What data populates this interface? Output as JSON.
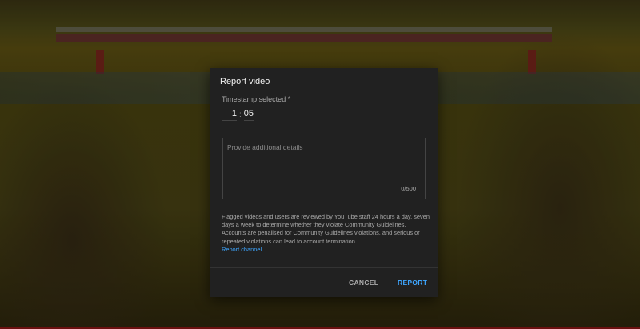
{
  "dialog": {
    "title": "Report video",
    "timestamp_label": "Timestamp selected *",
    "timestamp_minutes": "1",
    "timestamp_separator": ":",
    "timestamp_seconds": "05",
    "details_placeholder": "Provide additional details",
    "details_value": "",
    "char_count": "0/500",
    "info_text": "Flagged videos and users are reviewed by YouTube staff 24 hours a day, seven days a week to determine whether they violate Community Guidelines. Accounts are penalised for Community Guidelines violations, and serious or repeated violations can lead to account termination.",
    "report_channel_link": "Report channel",
    "cancel_label": "CANCEL",
    "report_label": "REPORT"
  },
  "colors": {
    "accent": "#3ea6ff",
    "dialog_bg": "#212121"
  }
}
